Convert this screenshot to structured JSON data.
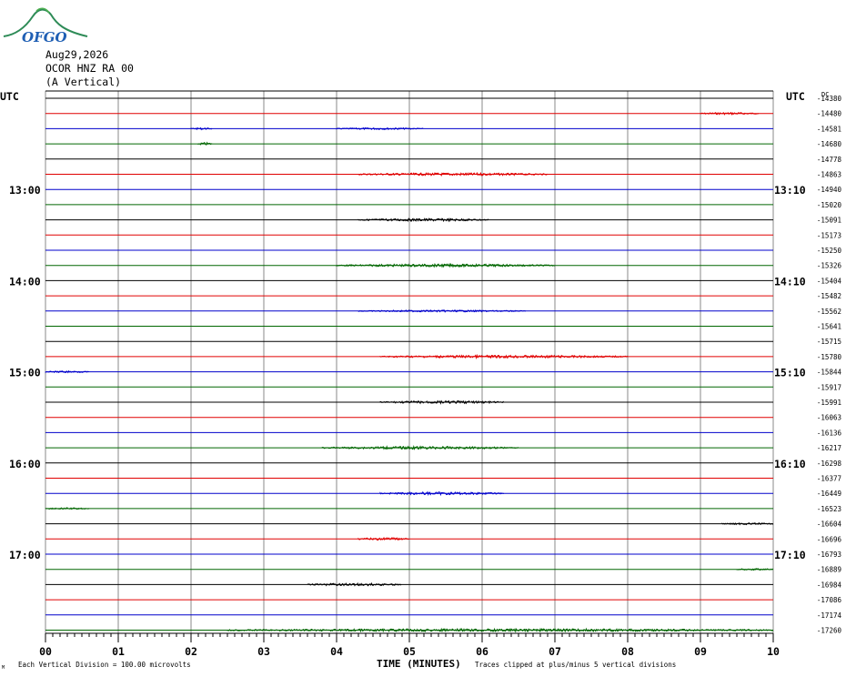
{
  "header": {
    "logo_text": "OFGO",
    "date": "Aug29,2026",
    "station": "OCOR HNZ RA 00",
    "component": "(A Vertical)",
    "utc_left": "UTC",
    "utc_right": "UTC",
    "right_unit": "DC"
  },
  "footer": {
    "scale_note": "Each Vertical Division =  100.00 microvolts",
    "corner_mark": "M",
    "xlabel": "TIME (MINUTES)",
    "clip_note": "Traces clipped at plus/minus 5 vertical divisions"
  },
  "chart_data": {
    "type": "line",
    "title": "Aug29,2026 OCOR HNZ RA 00 (A Vertical)",
    "xlabel": "TIME (MINUTES)",
    "x_ticks": [
      "00",
      "01",
      "02",
      "03",
      "04",
      "05",
      "06",
      "07",
      "08",
      "09",
      "10"
    ],
    "xlim": [
      0,
      10
    ],
    "trace_colors": [
      "#000000",
      "#e00000",
      "#0000cc",
      "#006600"
    ],
    "grid": true,
    "left_time_labels": [
      {
        "trace": 6,
        "label": "13:00"
      },
      {
        "trace": 12,
        "label": "14:00"
      },
      {
        "trace": 18,
        "label": "15:00"
      },
      {
        "trace": 24,
        "label": "16:00"
      },
      {
        "trace": 30,
        "label": "17:00"
      }
    ],
    "right_time_labels": [
      {
        "trace": 6,
        "label": "13:10"
      },
      {
        "trace": 12,
        "label": "14:10"
      },
      {
        "trace": 18,
        "label": "15:10"
      },
      {
        "trace": 24,
        "label": "16:10"
      },
      {
        "trace": 30,
        "label": "17:10"
      }
    ],
    "dc_offsets": [
      "-14380",
      "-14480",
      "-14581",
      "-14680",
      "-14778",
      "-14863",
      "-14940",
      "-15020",
      "-15091",
      "-15173",
      "-15250",
      "-15326",
      "-15404",
      "-15482",
      "-15562",
      "-15641",
      "-15715",
      "-15780",
      "-15844",
      "-15917",
      "-15991",
      "-16063",
      "-16136",
      "-16217",
      "-16298",
      "-16377",
      "-16449",
      "-16523",
      "-16604",
      "-16696",
      "-16793",
      "-16889",
      "-16984",
      "-17086",
      "-17174",
      "-17260"
    ],
    "activity": [
      {
        "trace": 1,
        "segments": [
          [
            9.0,
            9.8,
            1.2
          ]
        ]
      },
      {
        "trace": 2,
        "segments": [
          [
            2.0,
            2.3,
            1.0
          ],
          [
            4.0,
            5.2,
            1.0
          ]
        ]
      },
      {
        "trace": 3,
        "segments": [
          [
            2.1,
            2.3,
            1.5
          ]
        ]
      },
      {
        "trace": 5,
        "segments": [
          [
            4.3,
            6.9,
            1.5
          ]
        ]
      },
      {
        "trace": 8,
        "segments": [
          [
            4.3,
            6.1,
            1.5
          ]
        ]
      },
      {
        "trace": 11,
        "segments": [
          [
            4.0,
            7.0,
            1.5
          ]
        ]
      },
      {
        "trace": 14,
        "segments": [
          [
            4.3,
            6.6,
            1.0
          ]
        ]
      },
      {
        "trace": 17,
        "segments": [
          [
            4.6,
            8.0,
            1.5
          ]
        ]
      },
      {
        "trace": 18,
        "segments": [
          [
            0.0,
            0.6,
            1.0
          ]
        ]
      },
      {
        "trace": 20,
        "segments": [
          [
            4.6,
            6.3,
            1.5
          ]
        ]
      },
      {
        "trace": 23,
        "segments": [
          [
            3.8,
            6.5,
            1.5
          ]
        ]
      },
      {
        "trace": 26,
        "segments": [
          [
            4.6,
            6.3,
            1.5
          ]
        ]
      },
      {
        "trace": 27,
        "segments": [
          [
            0.0,
            0.6,
            1.0
          ]
        ]
      },
      {
        "trace": 28,
        "segments": [
          [
            9.3,
            10.0,
            1.0
          ]
        ]
      },
      {
        "trace": 29,
        "segments": [
          [
            4.3,
            5.0,
            1.5
          ]
        ]
      },
      {
        "trace": 31,
        "segments": [
          [
            9.5,
            10.0,
            1.0
          ]
        ]
      },
      {
        "trace": 32,
        "segments": [
          [
            3.6,
            4.9,
            1.5
          ]
        ]
      },
      {
        "trace": 35,
        "segments": [
          [
            2.5,
            10.0,
            1.5
          ]
        ]
      }
    ]
  }
}
